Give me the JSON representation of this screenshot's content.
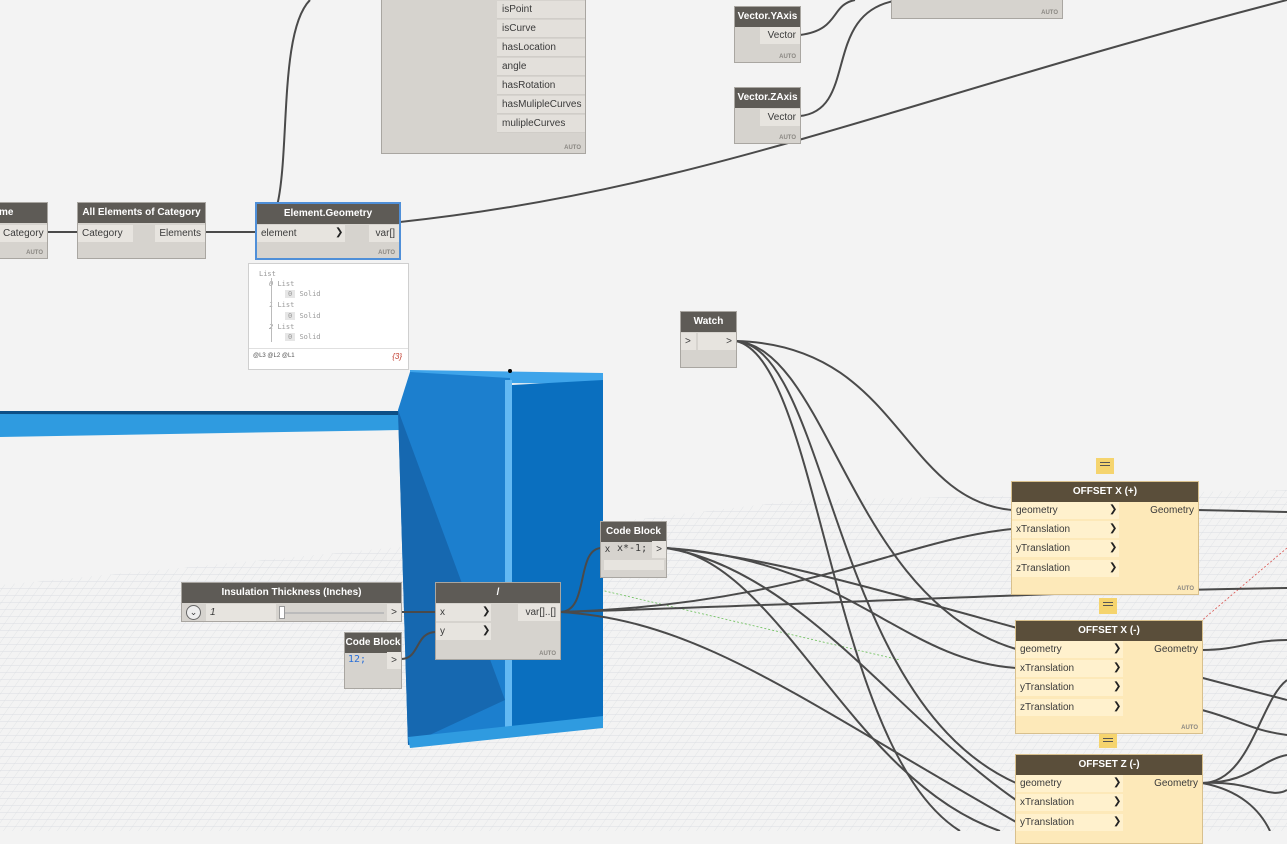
{
  "colors": {
    "background": "#f3f3f3",
    "node_header": "#5e5b56",
    "node_body": "#d6d3ce",
    "group_yellow": "#fde9b9",
    "group_header": "#5a4e3a",
    "selection": "#4f8fd8",
    "geometry_blue": "#1c7fce",
    "wire": "#4a4a4a"
  },
  "auto_label": "AUTO",
  "node_partial_name": {
    "title": "me",
    "output": "Category"
  },
  "node_all_elements": {
    "title": "All Elements of Category",
    "input": "Category",
    "output": "Elements"
  },
  "node_element_geometry": {
    "title": "Element.Geometry",
    "input": "element",
    "output": "var[]"
  },
  "geometry_preview": {
    "root": "List",
    "items": [
      {
        "index": "0",
        "label": "List",
        "value": "Solid",
        "sub_index": "0"
      },
      {
        "index": "1",
        "label": "List",
        "value": "Solid",
        "sub_index": "0"
      },
      {
        "index": "2",
        "label": "List",
        "value": "Solid",
        "sub_index": "0"
      }
    ],
    "levels": "@L3 @L2 @L1",
    "count": "{3}"
  },
  "node_props": {
    "outputs": [
      "isPoint",
      "isCurve",
      "hasLocation",
      "angle",
      "hasRotation",
      "hasMulipleCurves",
      "mulipleCurves"
    ]
  },
  "node_vector_y": {
    "title": "Vector.YAxis",
    "output": "Vector"
  },
  "node_vector_z": {
    "title": "Vector.ZAxis",
    "output": "Vector"
  },
  "node_watch": {
    "title": "Watch",
    "input": ">",
    "output": ">"
  },
  "node_insulation": {
    "title": "Insulation Thickness (Inches)",
    "value": "1",
    "output": ">"
  },
  "node_code_12": {
    "title": "Code Block",
    "code": "12;",
    "output": ">"
  },
  "node_divide": {
    "title": "/",
    "inputs": [
      "x",
      "y"
    ],
    "output": "var[]..[]"
  },
  "node_code_neg": {
    "title": "Code Block",
    "input": "x",
    "code": "x*-1;",
    "output": ">"
  },
  "node_offset_x_pos": {
    "title": "OFFSET X (+)",
    "inputs": [
      "geometry",
      "xTranslation",
      "yTranslation",
      "zTranslation"
    ],
    "output": "Geometry"
  },
  "node_offset_x_neg": {
    "title": "OFFSET X (-)",
    "inputs": [
      "geometry",
      "xTranslation",
      "yTranslation",
      "zTranslation"
    ],
    "output": "Geometry"
  },
  "node_offset_z_neg": {
    "title": "OFFSET Z (-)",
    "inputs": [
      "geometry",
      "xTranslation",
      "yTranslation"
    ],
    "output": "Geometry"
  }
}
